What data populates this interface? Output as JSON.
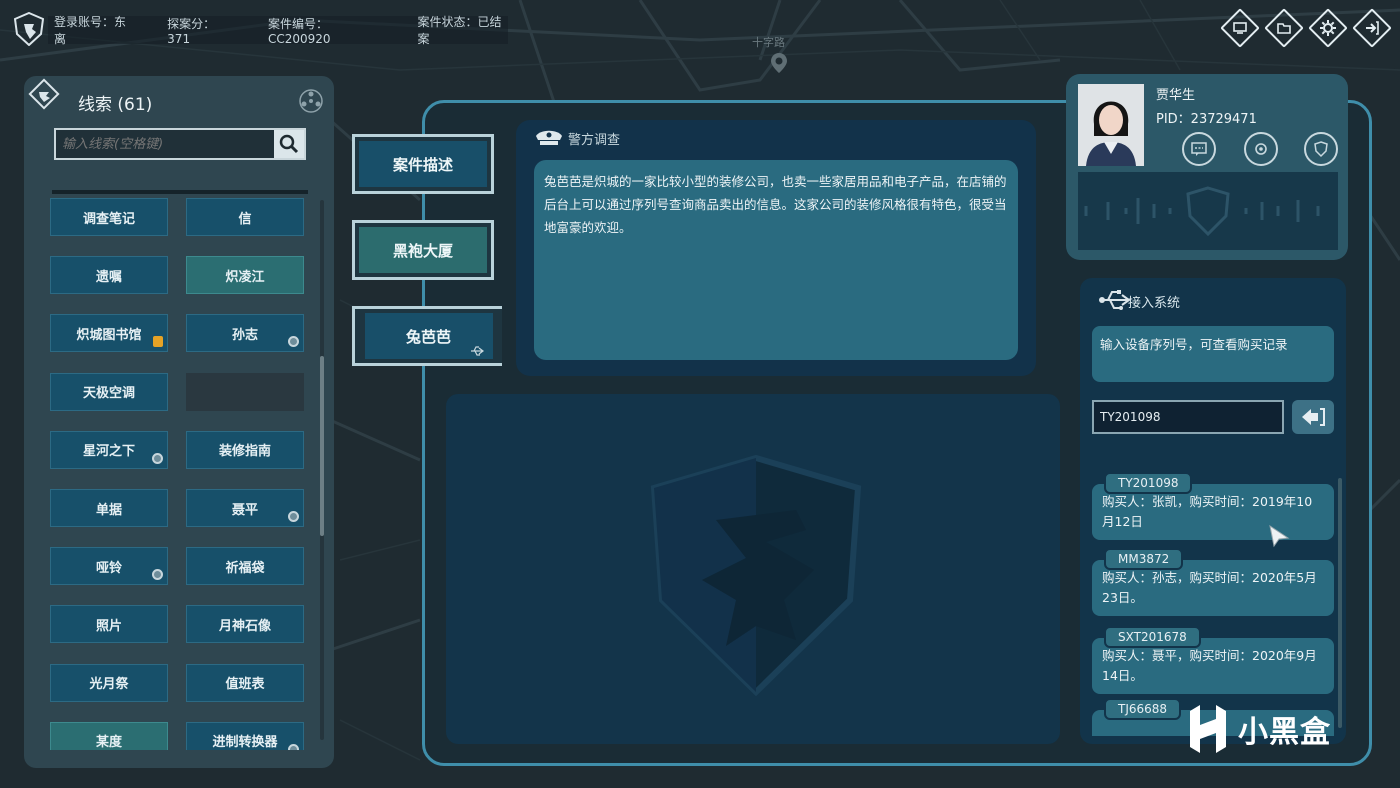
{
  "top_bar": {
    "account": "登录账号：东离",
    "score": "探案分：371",
    "case_no": "案件编号：CC200920",
    "case_status": "案件状态：已结案",
    "icons": [
      "monitor-icon",
      "folder-icon",
      "gear-icon",
      "exit-icon"
    ]
  },
  "map": {
    "label": "十字路",
    "pin_icon": "location-pin-icon"
  },
  "clues": {
    "title": "线索 (61)",
    "search_placeholder": "输入线索(空格键)",
    "items": [
      {
        "label": "调查笔记",
        "style": "blue",
        "badge": ""
      },
      {
        "label": "信",
        "style": "blue",
        "badge": ""
      },
      {
        "label": "遗嘱",
        "style": "blue",
        "badge": ""
      },
      {
        "label": "炽凌江",
        "style": "teal",
        "badge": ""
      },
      {
        "label": "炽城图书馆",
        "style": "blue",
        "badge": "shield"
      },
      {
        "label": "孙志",
        "style": "blue",
        "badge": "dot"
      },
      {
        "label": "天极空调",
        "style": "blue",
        "badge": ""
      },
      {
        "label": "",
        "style": "empty",
        "badge": ""
      },
      {
        "label": "星河之下",
        "style": "blue",
        "badge": "link"
      },
      {
        "label": "装修指南",
        "style": "blue",
        "badge": ""
      },
      {
        "label": "单据",
        "style": "blue",
        "badge": ""
      },
      {
        "label": "聂平",
        "style": "blue",
        "badge": "dot"
      },
      {
        "label": "哑铃",
        "style": "blue",
        "badge": "link"
      },
      {
        "label": "祈福袋",
        "style": "blue",
        "badge": ""
      },
      {
        "label": "照片",
        "style": "blue",
        "badge": ""
      },
      {
        "label": "月神石像",
        "style": "blue",
        "badge": ""
      },
      {
        "label": "光月祭",
        "style": "blue",
        "badge": ""
      },
      {
        "label": "值班表",
        "style": "blue",
        "badge": ""
      },
      {
        "label": "某度",
        "style": "teal",
        "badge": ""
      },
      {
        "label": "进制转换器",
        "style": "blue",
        "badge": "link"
      }
    ]
  },
  "tabs": [
    {
      "label": "案件描述",
      "style": "blue"
    },
    {
      "label": "黑袍大厦",
      "style": "teal"
    },
    {
      "label": "兔芭芭",
      "style": "blue"
    }
  ],
  "police": {
    "title": "警方调查",
    "text": "兔芭芭是炽城的一家比较小型的装修公司，也卖一些家居用品和电子产品，在店铺的后台上可以通过序列号查询商品卖出的信息。这家公司的装修风格很有特色，很受当地富豪的欢迎。"
  },
  "profile": {
    "name": "贾华生",
    "pid": "PID：23729471",
    "buttons": [
      "chat-icon",
      "settings-icon",
      "badge-icon"
    ]
  },
  "access": {
    "title": "接入系统",
    "description": "输入设备序列号，可查看购买记录",
    "serial_value": "TY201098",
    "records": [
      {
        "serial": "TY201098",
        "text": "购买人：张凯，购买时间：2019年10月12日"
      },
      {
        "serial": "MM3872",
        "text": "购买人：孙志，购买时间：2020年5月23日。"
      },
      {
        "serial": "SXT201678",
        "text": "购买人：聂平，购买时间：2020年9月14日。"
      },
      {
        "serial": "TJ66688",
        "text": ""
      }
    ]
  },
  "watermark": {
    "text": "小黑盒"
  },
  "colors": {
    "accent_border": "#3f8eaa",
    "panel_blue": "#17506a",
    "panel_teal": "#2b6e72",
    "text_box": "#2a6b80"
  }
}
